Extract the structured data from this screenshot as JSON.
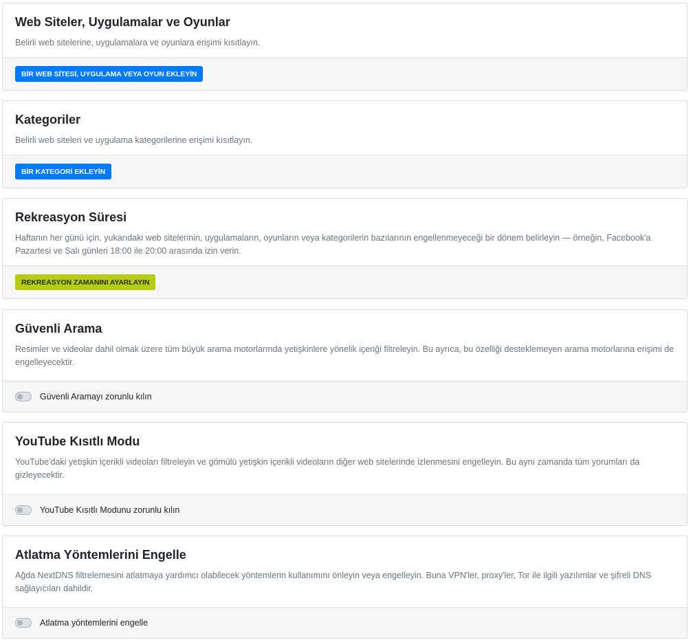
{
  "sections": {
    "websites": {
      "title": "Web Siteler, Uygulamalar ve Oyunlar",
      "description": "Belirli web sitelerine, uygulamalara ve oyunlara erişimi kısıtlayın.",
      "button_label": "BİR WEB SİTESİ, UYGULAMA VEYA OYUN EKLEYİN"
    },
    "categories": {
      "title": "Kategoriler",
      "description": "Belirli web siteleri ve uygulama kategorilerine erişimi kısıtlayın.",
      "button_label": "BİR KATEGORİ EKLEYİN"
    },
    "recreation": {
      "title": "Rekreasyon Süresi",
      "description": "Haftanın her günü için, yukarıdaki web sitelerinin, uygulamaların, oyunların veya kategorilerin bazılarının engellenmeyeceği bir dönem belirleyin — örneğin, Facebook'a Pazartesi ve Salı günleri 18:00 ile 20:00 arasında izin verin.",
      "button_label": "REKREASYON ZAMANINI AYARLAYIN"
    },
    "safesearch": {
      "title": "Güvenli Arama",
      "description": "Resimler ve videolar dahil olmak üzere tüm büyük arama motorlarında yetişkinlere yönelik içeriği filtreleyin. Bu ayrıca, bu özelliği desteklemeyen arama motorlarına erişimi de engelleyecektir.",
      "toggle_label": "Güvenli Aramayı zorunlu kılın",
      "enabled": false
    },
    "youtube": {
      "title": "YouTube Kısıtlı Modu",
      "description": "YouTube'daki yetişkin içerikli videoları filtreleyin ve gömülü yetişkin içerikli videoların diğer web sitelerinde izlenmesini engelleyin. Bu aynı zamanda tüm yorumları da gizleyecektir.",
      "toggle_label": "YouTube Kısıtlı Modunu zorunlu kılın",
      "enabled": false
    },
    "bypass": {
      "title": "Atlatma Yöntemlerini Engelle",
      "description": "Ağda NextDNS filtrelemesini atlatmaya yardımcı olabilecek yöntemlerin kullanımını önleyin veya engelleyin. Buna VPN'ler, proxy'ler, Tor ile ilgili yazılımlar ve şifreli DNS sağlayıcıları dahildir.",
      "toggle_label": "Atlatma yöntemlerini engelle",
      "enabled": false
    }
  },
  "colors": {
    "primary_button": "#007bff",
    "recreation_button": "#b8cc13",
    "footer_bg": "#f6f6f6",
    "muted_text": "#6c757d"
  }
}
